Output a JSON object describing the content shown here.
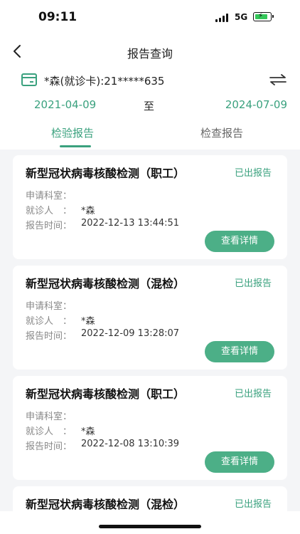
{
  "status_bar": {
    "time": "09:11",
    "network": "5G"
  },
  "nav": {
    "title": "报告查询"
  },
  "patient": {
    "text": "*森(就诊卡):21*****635"
  },
  "date_range": {
    "start": "2021-04-09",
    "separator": "至",
    "end": "2024-07-09"
  },
  "tabs": [
    {
      "label": "检验报告",
      "active": true
    },
    {
      "label": "检查报告",
      "active": false
    }
  ],
  "labels": {
    "dept": "申请科室：",
    "patient": "就诊人　：",
    "time": "报告时间：",
    "detail_button": "查看详情"
  },
  "reports": [
    {
      "title": "新型冠状病毒核酸检测（职工）",
      "status": "已出报告",
      "dept": "",
      "patient": "*森",
      "time": "2022-12-13 13:44:51"
    },
    {
      "title": "新型冠状病毒核酸检测（混检）",
      "status": "已出报告",
      "dept": "",
      "patient": "*森",
      "time": "2022-12-09 13:28:07"
    },
    {
      "title": "新型冠状病毒核酸检测（职工）",
      "status": "已出报告",
      "dept": "",
      "patient": "*森",
      "time": "2022-12-08 13:10:39"
    },
    {
      "title": "新型冠状病毒核酸检测（混检）",
      "status": "已出报告"
    }
  ],
  "colors": {
    "accent": "#3aa17e",
    "button": "#4caf87",
    "battery": "#34c759"
  }
}
